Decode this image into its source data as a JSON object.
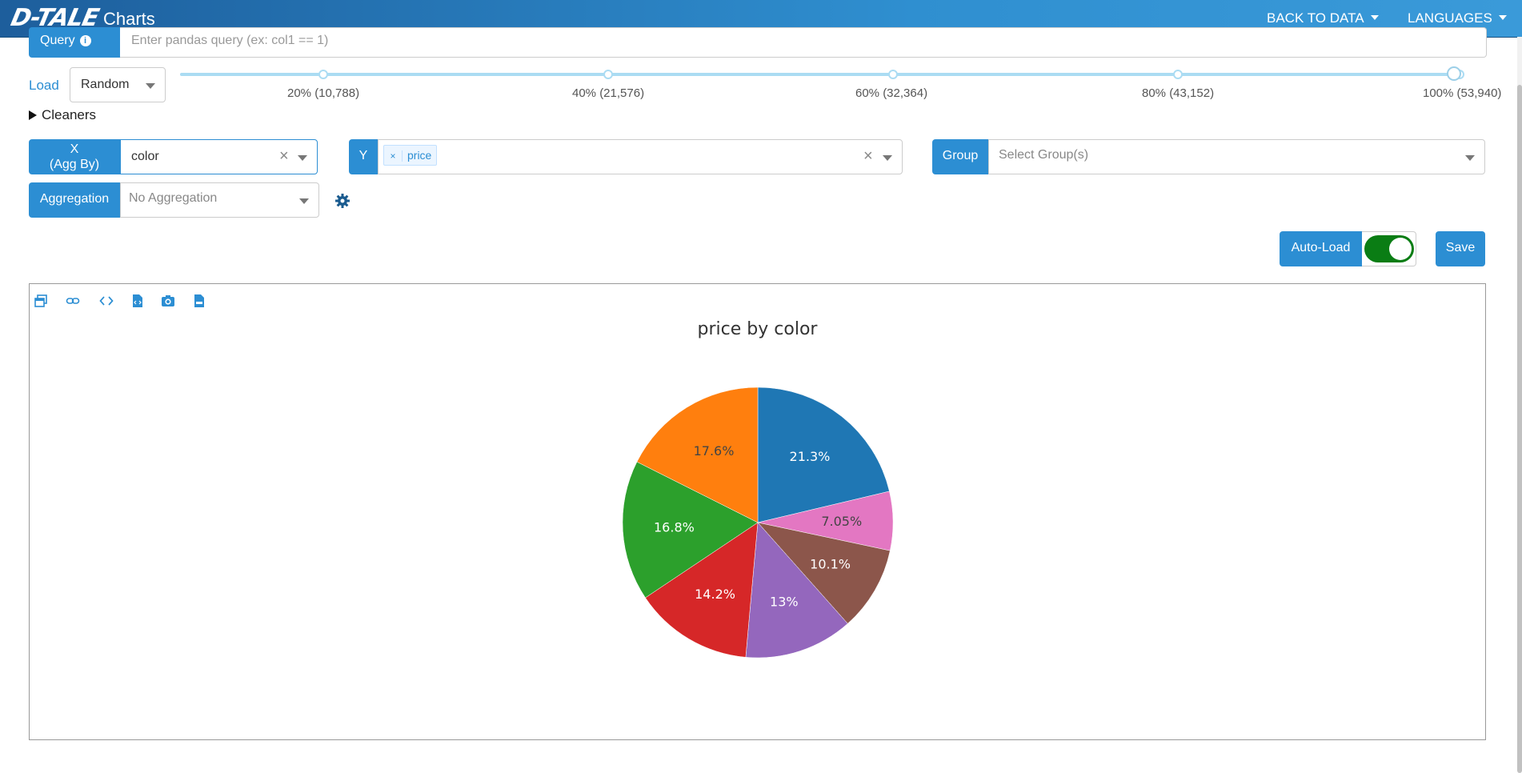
{
  "navbar": {
    "logo": "D-TALE",
    "title": "Charts",
    "back_to_data": "BACK TO DATA",
    "languages": "LANGUAGES"
  },
  "query": {
    "label": "Query",
    "info_icon": "info-icon",
    "placeholder": "Enter pandas query (ex: col1 == 1)"
  },
  "load": {
    "label": "Load",
    "selected": "Random",
    "marks": [
      "20% (10,788)",
      "40% (21,576)",
      "60% (32,364)",
      "80% (43,152)",
      "100% (53,940)"
    ],
    "value_percent": 100
  },
  "cleaners": {
    "label": "Cleaners"
  },
  "x_field": {
    "label_line1": "X",
    "label_line2": "(Agg By)",
    "value": "color"
  },
  "y_field": {
    "label": "Y",
    "tags": [
      "price"
    ]
  },
  "group_field": {
    "label": "Group",
    "placeholder": "Select Group(s)"
  },
  "aggregation": {
    "label": "Aggregation",
    "value": "No Aggregation"
  },
  "autoload": {
    "label": "Auto-Load",
    "enabled": true
  },
  "save": {
    "label": "Save"
  },
  "toolbar_icons": [
    "popup-icon",
    "link-icon",
    "code-icon",
    "export-html-icon",
    "camera-icon",
    "export-csv-icon"
  ],
  "colors": {
    "accent": "#2c8ed3",
    "toggle_on": "#0a7d14"
  },
  "chart_data": {
    "type": "pie",
    "title": "price by color",
    "slices": [
      {
        "label": "21.3%",
        "value": 21.3,
        "color": "#1f77b4",
        "text_color": "#ffffff"
      },
      {
        "label": "7.05%",
        "value": 7.05,
        "color": "#e377c2",
        "text_color": "#444444"
      },
      {
        "label": "10.1%",
        "value": 10.1,
        "color": "#8c564b",
        "text_color": "#ffffff"
      },
      {
        "label": "13%",
        "value": 13.0,
        "color": "#9467bd",
        "text_color": "#ffffff"
      },
      {
        "label": "14.2%",
        "value": 14.2,
        "color": "#d62728",
        "text_color": "#ffffff"
      },
      {
        "label": "16.8%",
        "value": 16.8,
        "color": "#2ca02c",
        "text_color": "#ffffff"
      },
      {
        "label": "17.6%",
        "value": 17.6,
        "color": "#ff7f0e",
        "text_color": "#444444"
      }
    ]
  }
}
